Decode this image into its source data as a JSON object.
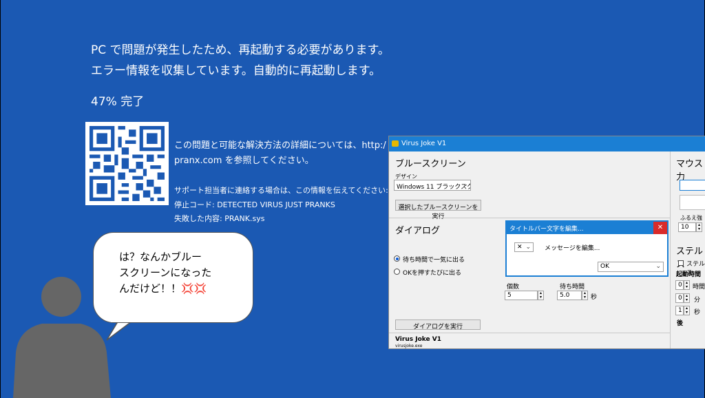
{
  "bsod": {
    "line1": "PC で問題が発生したため、再起動する必要があります。",
    "line2": "エラー情報を収集しています。自動的に再起動します。",
    "progress": "47% 完了",
    "info_line1": "この問題と可能な解決方法の詳細については、http:/",
    "info_line2": "pranx.com を参照してください。",
    "support": "サポート担当者に連絡する場合は、この情報を伝えてください:",
    "stop_code": "停止コード: DETECTED VIRUS JUST PRANKS",
    "failed": "失敗した内容: PRANK.sys",
    "colors": {
      "background": "#1b59b3",
      "text": "#ffffff"
    }
  },
  "speech": {
    "text": "は？なんかブルー\nスクリーンになった\nんだけど！！💢💢"
  },
  "app": {
    "title": "Virus Joke V1",
    "bluescreen": {
      "heading": "ブルースクリーン",
      "design_label": "デザイン",
      "design_value": "Windows 11 ブラックスクリ",
      "run_button": "選択したブルースクリーンを実行"
    },
    "dialog": {
      "heading": "ダイアログ",
      "radio_wait": "待ち時間で一気に出る",
      "radio_ok": "OKを押すたびに出る",
      "count_label": "個数",
      "count_value": "5",
      "wait_label": "待ち時間",
      "wait_value": "5.0",
      "wait_unit": "秒",
      "run_button": "ダイアログを実行"
    },
    "popup": {
      "title": "タイトルバー文字を編集...",
      "close": "✕",
      "icon_value": "✕",
      "message": "メッセージを編集...",
      "button_value": "OK"
    },
    "mouse": {
      "heading": "マウス力",
      "shake_label": "ふるえ強度",
      "shake_value": "10"
    },
    "stealth": {
      "heading": "ステルス",
      "checkbox_label": "ステルス",
      "start_time": "起動時間",
      "hours_value": "0",
      "hours_unit": "時間",
      "minutes_value": "0",
      "minutes_unit": "分",
      "seconds_value": "1",
      "seconds_unit": "秒",
      "after": "後"
    },
    "footer": {
      "name": "Virus Joke V1",
      "file": "virusjoke.exe"
    }
  }
}
